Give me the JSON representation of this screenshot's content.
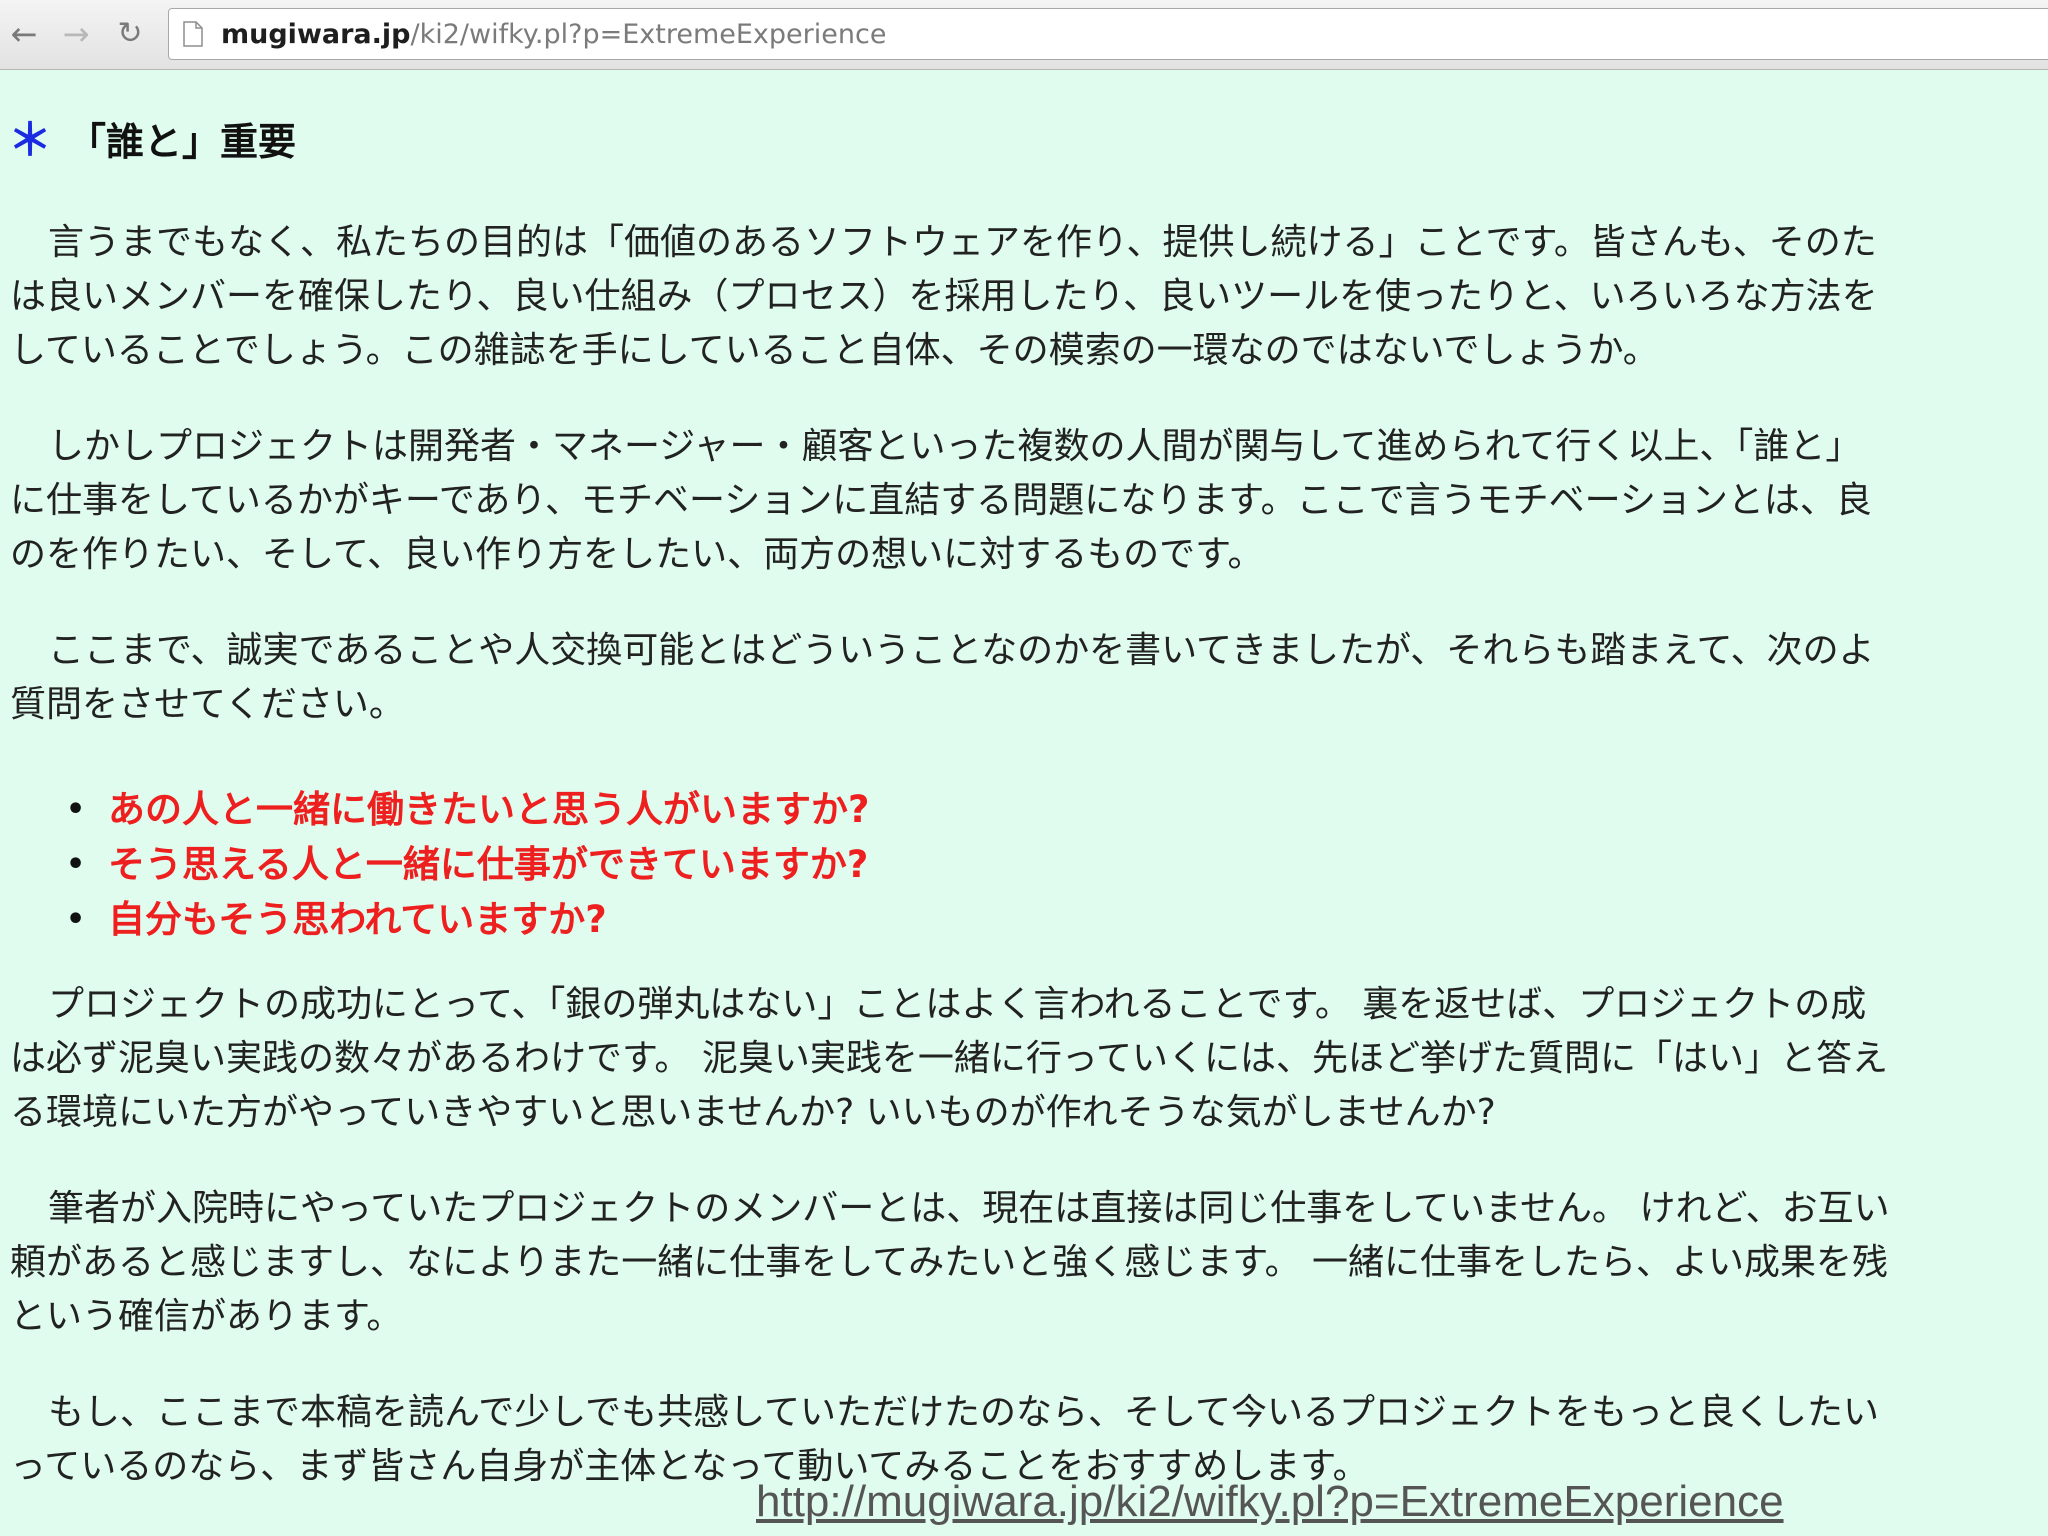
{
  "browser": {
    "url_host": "mugiwara.jp",
    "url_path": "/ki2/wifky.pl?p=ExtremeExperience",
    "back_icon": "back-arrow-icon",
    "forward_icon": "forward-arrow-icon",
    "reload_icon": "reload-icon"
  },
  "article": {
    "heading_mark": "＊",
    "heading": "「誰と」重要",
    "paragraphs": [
      {
        "lines": [
          "言うまでもなく、私たちの目的は「価値のあるソフトウェアを作り、提供し続ける」ことです。皆さんも、そのた",
          "は良いメンバーを確保したり、良い仕組み（プロセス）を採用したり、良いツールを使ったりと、いろいろな方法を",
          "していることでしょう。この雑誌を手にしていること自体、その模索の一環なのではないでしょうか。"
        ]
      },
      {
        "lines": [
          "しかしプロジェクトは開発者・マネージャー・顧客といった複数の人間が関与して進められて行く以上、「誰と」",
          "に仕事をしているかがキーであり、モチベーションに直結する問題になります。ここで言うモチベーションとは、良",
          "のを作りたい、そして、良い作り方をしたい、両方の想いに対するものです。"
        ]
      },
      {
        "lines": [
          "ここまで、誠実であることや人交換可能とはどういうことなのかを書いてきましたが、それらも踏まえて、次のよ",
          "質問をさせてください。"
        ]
      },
      {
        "lines": [
          "プロジェクトの成功にとって、「銀の弾丸はない」ことはよく言われることです。 裏を返せば、プロジェクトの成",
          "は必ず泥臭い実践の数々があるわけです。 泥臭い実践を一緒に行っていくには、先ほど挙げた質問に「はい」と答え",
          "る環境にいた方がやっていきやすいと思いませんか? いいものが作れそうな気がしませんか?"
        ]
      },
      {
        "lines": [
          "筆者が入院時にやっていたプロジェクトのメンバーとは、現在は直接は同じ仕事をしていません。 けれど、お互い",
          "頼があると感じますし、なによりまた一緒に仕事をしてみたいと強く感じます。 一緒に仕事をしたら、よい成果を残",
          "という確信があります。"
        ]
      },
      {
        "lines": [
          "もし、ここまで本稿を読んで少しでも共感していただけたのなら、そして今いるプロジェクトをもっと良くしたい",
          "っているのなら、まず皆さん自身が主体となって動いてみることをおすすめします。"
        ]
      }
    ],
    "questions": [
      "あの人と一緒に働きたいと思う人がいますか?",
      "そう思える人と一緒に仕事ができていますか?",
      "自分もそう思われていますか?"
    ],
    "bullet_char": "•"
  },
  "overlay": {
    "source_url": "http://mugiwara.jp/ki2/wifky.pl?p=ExtremeExperience"
  },
  "colors": {
    "page_background": "#dffcef",
    "question_text": "#ee1f1f",
    "heading_mark": "#1a2be0"
  }
}
